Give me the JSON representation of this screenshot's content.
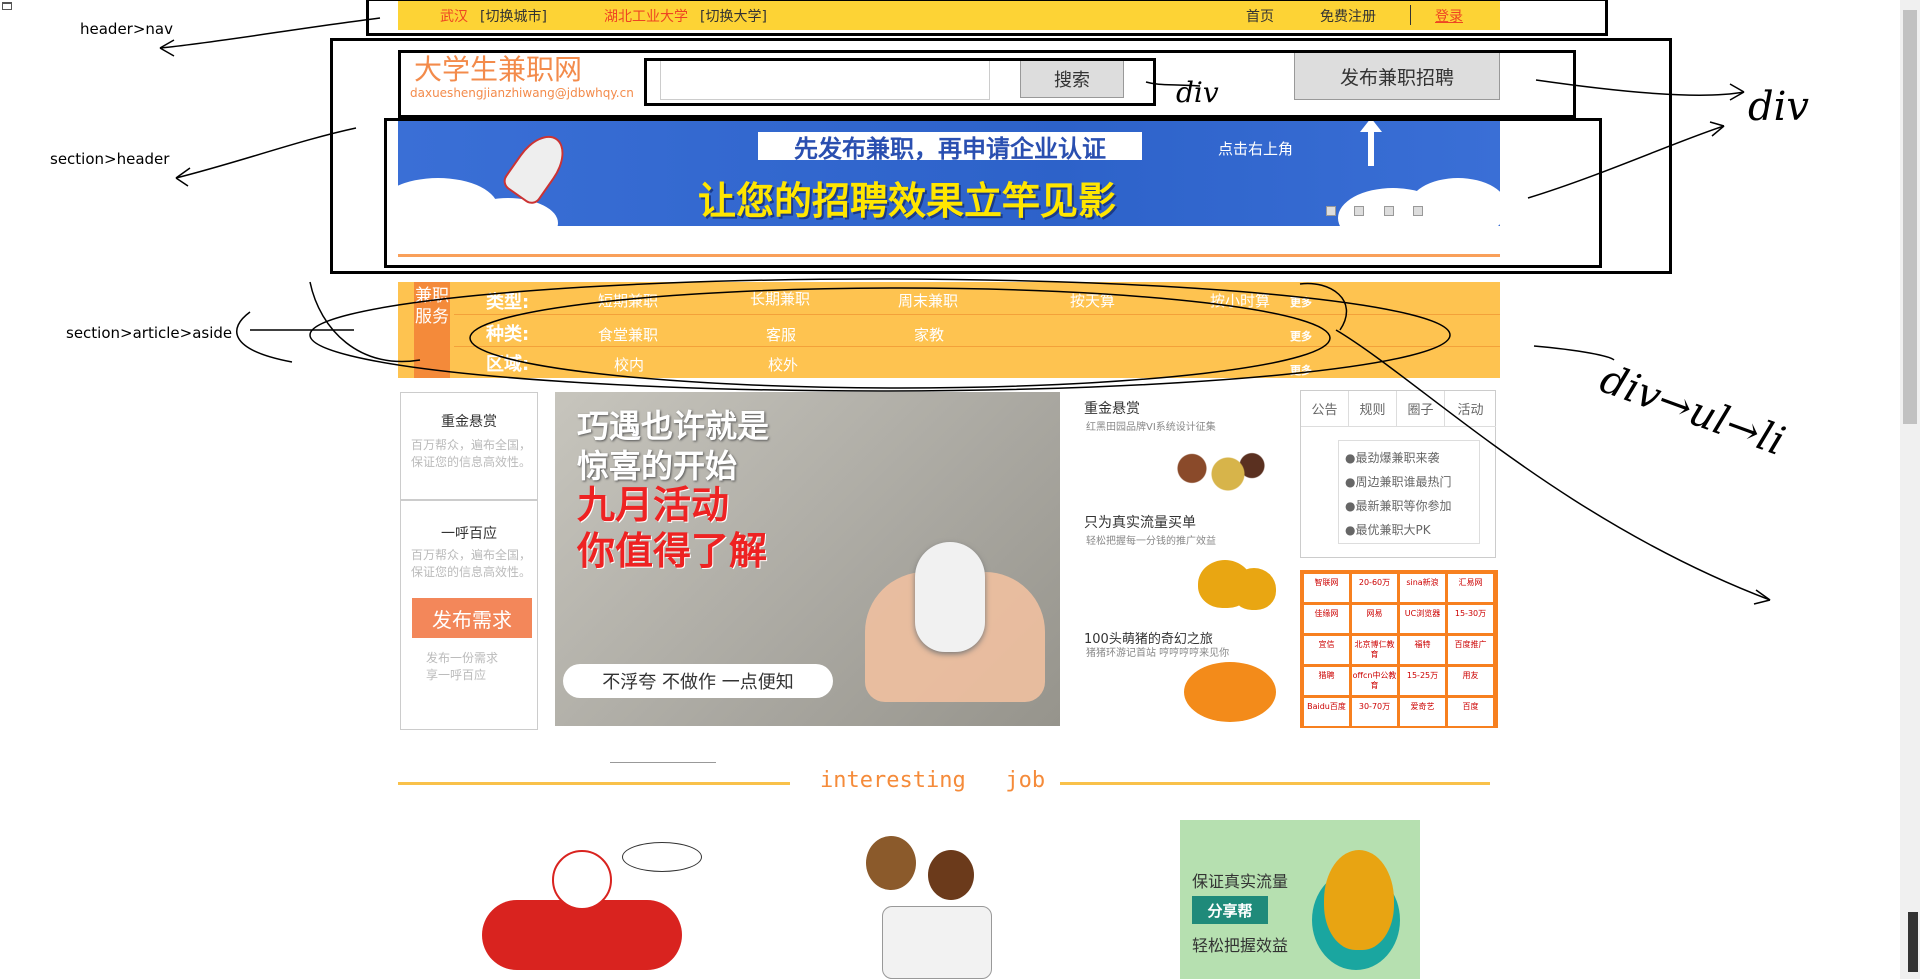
{
  "topnav": {
    "city": "武汉",
    "switch_city": "[切换城市]",
    "university": "湖北工业大学",
    "switch_university": "[切换大学]",
    "home": "首页",
    "register": "免费注册",
    "login": "登录"
  },
  "brand": {
    "title": "大学生兼职网",
    "subtitle": "daxueshengjianzhiwang@jdbwhqy.cn"
  },
  "search": {
    "placeholder": "",
    "button": "搜索"
  },
  "publish_button": "发布兼职招聘",
  "banner": {
    "line1": "先发布兼职，再申请企业认证",
    "hint": "点击右上角",
    "line2": "让您的招聘效果立竿见影"
  },
  "categories": {
    "side_label": "兼职服务",
    "rows": [
      {
        "label": "类型:",
        "items": [
          "短期兼职",
          "长期兼职",
          "周末兼职",
          "按天算",
          "按小时算"
        ],
        "more": "更多"
      },
      {
        "label": "种类:",
        "items": [
          "食堂兼职",
          "客服",
          "家教"
        ],
        "more": "更多"
      },
      {
        "label": "区域:",
        "items": [
          "校内",
          "校外"
        ],
        "more": "更多"
      }
    ]
  },
  "left_column": {
    "box1_title": "重金悬赏",
    "box1_desc": "百万帮众，遍布全国，保证您的信息高效性。",
    "box2_title": "一呼百应",
    "box2_desc": "百万帮众，遍布全国，保证您的信息高效性。",
    "request_button": "发布需求",
    "request_desc": "发布一份需求\n享一呼百应"
  },
  "promo": {
    "line1": "巧遇也许就是",
    "line2": "惊喜的开始",
    "line3": "九月活动",
    "line4": "你值得了解",
    "caption": "不浮夸 不做作 一点便知"
  },
  "middle_column": {
    "item1_title": "重金悬赏",
    "item1_sub": "红黑田园品牌VI系统设计征集",
    "item2_title": "只为真实流量买单",
    "item2_sub": "轻松把握每一分钱的推广效益",
    "item3_title": "100头萌猪的奇幻之旅",
    "item3_sub": "猪猪环游记首站 哼哼哼哼来见你"
  },
  "tabs": {
    "items": [
      "公告",
      "规则",
      "圈子",
      "活动"
    ],
    "notices": [
      "●最劲爆兼职来袭",
      "●周边兼职谁最热门",
      "●最新兼职等你参加",
      "●最优兼职大PK"
    ]
  },
  "ads": [
    "智联网",
    "20-60万",
    "sina新浪",
    "汇易网",
    "佳缘网",
    "网易",
    "UC浏览器",
    "15-30万",
    "宜信",
    "北京博仁教育",
    "福特",
    "百度推广",
    "猎聘",
    "offcn中公教育",
    "15-25万",
    "用友",
    "Baidu百度",
    "30-70万",
    "爱奇艺",
    "百度"
  ],
  "section": {
    "title": "interesting   job"
  },
  "bottom": {
    "img3_line1": "保证真实流量",
    "img3_button": "分享帮",
    "img3_line2": "轻松把握效益"
  },
  "annotations": {
    "a1": "header>nav",
    "a2": "section>header",
    "a3": "section>article>aside",
    "div1": "div",
    "div2": "div",
    "div3": "div→ul→li"
  },
  "colors": {
    "nav_yellow": "#fdd335",
    "category_orange": "#fec350",
    "accent_orange": "#f48a3a",
    "banner_blue": "#2d62c9"
  }
}
